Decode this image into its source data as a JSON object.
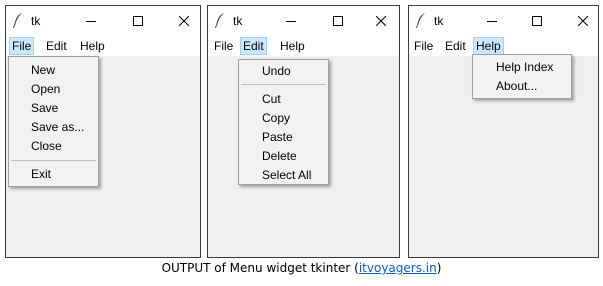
{
  "windows": [
    {
      "title": "tk",
      "menubar": [
        "File",
        "Edit",
        "Help"
      ],
      "open_menu": "File",
      "menu_items": [
        "New",
        "Open",
        "Save",
        "Save as...",
        "Close",
        "Exit"
      ]
    },
    {
      "title": "tk",
      "menubar": [
        "File",
        "Edit",
        "Help"
      ],
      "open_menu": "Edit",
      "menu_items": [
        "Undo",
        "Cut",
        "Copy",
        "Paste",
        "Delete",
        "Select All"
      ]
    },
    {
      "title": "tk",
      "menubar": [
        "File",
        "Edit",
        "Help"
      ],
      "open_menu": "Help",
      "menu_items": [
        "Help Index",
        "About..."
      ]
    }
  ],
  "icons": [
    "feather-icon",
    "minimize-icon",
    "maximize-icon",
    "close-icon"
  ],
  "caption": {
    "text": "OUTPUT of Menu widget tkinter (",
    "link": "itvoyagers.in",
    "suffix": ")"
  },
  "colors": {
    "menu_highlight": "#cce8ff",
    "link": "#0563c1"
  }
}
